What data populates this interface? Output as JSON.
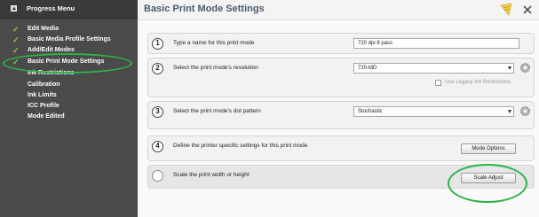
{
  "sidebar": {
    "title": "Progress Menu",
    "items": [
      {
        "label": "Edit Media",
        "checked": true
      },
      {
        "label": "Basic Media Profile Settings",
        "checked": true
      },
      {
        "label": "Add/Edit Modes",
        "checked": true
      },
      {
        "label": "Basic Print Mode Settings",
        "checked": true,
        "active": true
      },
      {
        "label": "Ink Restrictions",
        "checked": false
      },
      {
        "label": "Calibration",
        "checked": false
      },
      {
        "label": "Ink Limits",
        "checked": false
      },
      {
        "label": "ICC Profile",
        "checked": false
      },
      {
        "label": "Mode Edited",
        "checked": false
      }
    ]
  },
  "main": {
    "title": "Basic Print Mode Settings",
    "rows": [
      {
        "number": "1",
        "label": "Type a name for this print mode",
        "value": "720 dpi 8 pass"
      },
      {
        "number": "2",
        "label": "Select the print mode's resolution",
        "value": "720-MD",
        "checkbox_label": "Use Legacy Ink Restrictions"
      },
      {
        "number": "3",
        "label": "Select the print mode's dot pattern",
        "value": "Stochastic"
      },
      {
        "number": "4",
        "label": "Define the printer specific settings for this print mode",
        "button": "Mode Options"
      },
      {
        "number": "",
        "label": "Scale the print width or height",
        "button": "Scale Adjust"
      }
    ]
  },
  "colors": {
    "accent_green": "#2fb24a",
    "check_green": "#7bd13b",
    "sidebar_bg": "#4a4a4a"
  },
  "icons": {
    "edit": "pencil-note-icon",
    "close": "close-icon",
    "gear": "gear-icon"
  }
}
